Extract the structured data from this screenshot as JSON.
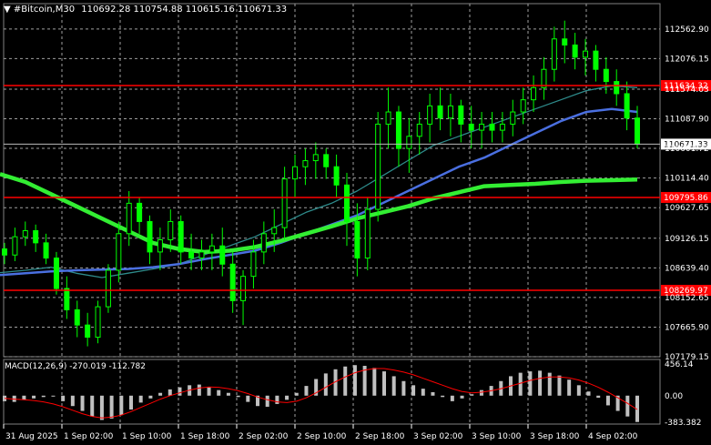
{
  "chart_data": {
    "type": "line",
    "chart_kind": "candlestick",
    "header": {
      "symbol": "#Bitcoin,M30",
      "ohlc": "110692.28 110754.88 110615.16 110671.33"
    },
    "price_axis": {
      "range": [
        107179.15,
        112800
      ],
      "tick_labels": [
        "112562.90",
        "112076.15",
        "111574.03",
        "111087.90",
        "110601.72",
        "110114.40",
        "109627.65",
        "109126.15",
        "108639.40",
        "108152.65",
        "107665.90",
        "107179.15"
      ]
    },
    "time_axis": {
      "tick_labels": [
        "31 Aug 2025",
        "1 Sep 02:00",
        "1 Sep 10:00",
        "1 Sep 18:00",
        "2 Sep 02:00",
        "2 Sep 10:00",
        "2 Sep 18:00",
        "3 Sep 02:00",
        "3 Sep 10:00",
        "3 Sep 18:00",
        "4 Sep 02:00"
      ]
    },
    "current_price": {
      "label": "110671.33",
      "value": 110671.33
    },
    "horizontal_levels": [
      {
        "label": "111634.32",
        "value": 111634.32,
        "color": "#ff0000"
      },
      {
        "label": "109795.86",
        "value": 109795.86,
        "color": "#ff0000"
      },
      {
        "label": "108269.97",
        "value": 108269.97,
        "color": "#ff0000"
      }
    ],
    "moving_averages": [
      {
        "color": "#2e8b8b",
        "values": [
          108560,
          108600,
          108650,
          108550,
          108480,
          108550,
          108620,
          108700,
          108850,
          109000,
          109150,
          109350,
          109550,
          109700,
          109900,
          110150,
          110400,
          110650,
          110800,
          110950,
          111100,
          111250,
          111400,
          111550,
          111630,
          111600
        ]
      },
      {
        "color": "#4a6fe0",
        "values": [
          108520,
          108550,
          108580,
          108600,
          108610,
          108620,
          108650,
          108700,
          108780,
          108850,
          108920,
          109050,
          109200,
          109350,
          109500,
          109700,
          109900,
          110100,
          110300,
          110450,
          110650,
          110850,
          111050,
          111200,
          111250,
          111200
        ]
      },
      {
        "color": "#33ee33",
        "values": [
          110180,
          110050,
          109850,
          109650,
          109450,
          109250,
          109050,
          108950,
          108900,
          108920,
          108980,
          109080,
          109200,
          109320,
          109450,
          109550,
          109650,
          109780,
          109880,
          109980,
          110000,
          110020,
          110050,
          110070,
          110080,
          110090
        ]
      }
    ],
    "ma_x_range": [
      0,
      700
    ],
    "candles": [
      [
        108950,
        109050,
        108700,
        108850
      ],
      [
        108850,
        109300,
        108750,
        109150
      ],
      [
        109150,
        109400,
        109000,
        109250
      ],
      [
        109250,
        109350,
        108900,
        109050
      ],
      [
        109050,
        109200,
        108700,
        108800
      ],
      [
        108800,
        108900,
        108200,
        108300
      ],
      [
        108300,
        108500,
        107800,
        107950
      ],
      [
        107950,
        108100,
        107500,
        107700
      ],
      [
        107700,
        107900,
        107350,
        107500
      ],
      [
        107500,
        108100,
        107400,
        108000
      ],
      [
        108000,
        108700,
        107900,
        108600
      ],
      [
        108600,
        109400,
        108400,
        109200
      ],
      [
        109200,
        109900,
        109000,
        109700
      ],
      [
        109700,
        109800,
        109200,
        109400
      ],
      [
        109400,
        109500,
        108700,
        108900
      ],
      [
        108900,
        109300,
        108600,
        109100
      ],
      [
        109100,
        109600,
        108900,
        109400
      ],
      [
        109400,
        109500,
        108700,
        108900
      ],
      [
        108900,
        109200,
        108600,
        108800
      ],
      [
        108800,
        109100,
        108600,
        108900
      ],
      [
        108900,
        109200,
        108600,
        109000
      ],
      [
        109000,
        109300,
        108500,
        108700
      ],
      [
        108700,
        108900,
        107900,
        108100
      ],
      [
        108100,
        108600,
        107700,
        108500
      ],
      [
        108500,
        109100,
        108300,
        108900
      ],
      [
        108900,
        109400,
        108700,
        109200
      ],
      [
        109200,
        109600,
        108900,
        109300
      ],
      [
        109300,
        110300,
        109100,
        110100
      ],
      [
        110100,
        110500,
        109800,
        110300
      ],
      [
        110300,
        110600,
        110000,
        110400
      ],
      [
        110400,
        110700,
        110100,
        110500
      ],
      [
        110500,
        110600,
        110100,
        110300
      ],
      [
        110300,
        110500,
        109800,
        110000
      ],
      [
        110000,
        110200,
        109000,
        109400
      ],
      [
        109400,
        109700,
        108500,
        108800
      ],
      [
        108800,
        109800,
        108600,
        109600
      ],
      [
        109600,
        111200,
        109400,
        111000
      ],
      [
        111000,
        111600,
        110600,
        111200
      ],
      [
        111200,
        111300,
        110300,
        110600
      ],
      [
        110600,
        111100,
        110200,
        110800
      ],
      [
        110800,
        111200,
        110500,
        111000
      ],
      [
        111000,
        111500,
        110700,
        111300
      ],
      [
        111300,
        111600,
        110900,
        111100
      ],
      [
        111100,
        111500,
        110800,
        111300
      ],
      [
        111300,
        111400,
        110700,
        111000
      ],
      [
        111000,
        111300,
        110600,
        110900
      ],
      [
        110900,
        111200,
        110600,
        111000
      ],
      [
        111000,
        111200,
        110700,
        110900
      ],
      [
        110900,
        111200,
        110700,
        111000
      ],
      [
        111000,
        111400,
        110800,
        111200
      ],
      [
        111200,
        111600,
        111000,
        111400
      ],
      [
        111400,
        111800,
        111200,
        111600
      ],
      [
        111600,
        112100,
        111400,
        111900
      ],
      [
        111900,
        112600,
        111700,
        112400
      ],
      [
        112400,
        112700,
        112000,
        112300
      ],
      [
        112300,
        112500,
        111900,
        112100
      ],
      [
        112100,
        112400,
        111800,
        112200
      ],
      [
        112200,
        112300,
        111700,
        111900
      ],
      [
        111900,
        112100,
        111500,
        111700
      ],
      [
        111700,
        111900,
        111300,
        111500
      ],
      [
        111500,
        111700,
        110900,
        111100
      ],
      [
        111100,
        111300,
        110600,
        110671
      ]
    ],
    "candle_x_range": [
      5,
      700
    ],
    "indicator": {
      "label": "MACD(12,26,9) -270.019 -112.782",
      "tick_labels": [
        "456.14",
        "0.00",
        "-383.382"
      ],
      "range": [
        -383.382,
        456.14
      ],
      "histogram": [
        -80,
        -90,
        -60,
        -40,
        -20,
        0,
        -80,
        -150,
        -220,
        -300,
        -350,
        -330,
        -280,
        -200,
        -100,
        -40,
        40,
        90,
        120,
        150,
        160,
        120,
        80,
        40,
        -20,
        -90,
        -150,
        -160,
        -120,
        -60,
        40,
        140,
        240,
        320,
        380,
        420,
        440,
        430,
        400,
        350,
        280,
        210,
        150,
        100,
        50,
        -20,
        -80,
        -40,
        20,
        80,
        140,
        210,
        280,
        330,
        350,
        360,
        330,
        290,
        230,
        150,
        60,
        -30,
        -140,
        -220,
        -300,
        -380
      ],
      "signal": [
        -40,
        -50,
        -60,
        -70,
        -90,
        -120,
        -160,
        -210,
        -260,
        -300,
        -320,
        -310,
        -280,
        -230,
        -170,
        -110,
        -50,
        0,
        40,
        80,
        110,
        125,
        120,
        100,
        70,
        30,
        -20,
        -60,
        -90,
        -100,
        -80,
        -30,
        40,
        120,
        200,
        270,
        330,
        370,
        390,
        390,
        370,
        340,
        300,
        250,
        200,
        150,
        100,
        60,
        40,
        50,
        70,
        100,
        140,
        180,
        220,
        250,
        270,
        270,
        255,
        225,
        180,
        120,
        50,
        -30,
        -110,
        -200
      ],
      "colors": {
        "histogram": "#c0c0c0",
        "signal": "#ff0000"
      }
    }
  }
}
